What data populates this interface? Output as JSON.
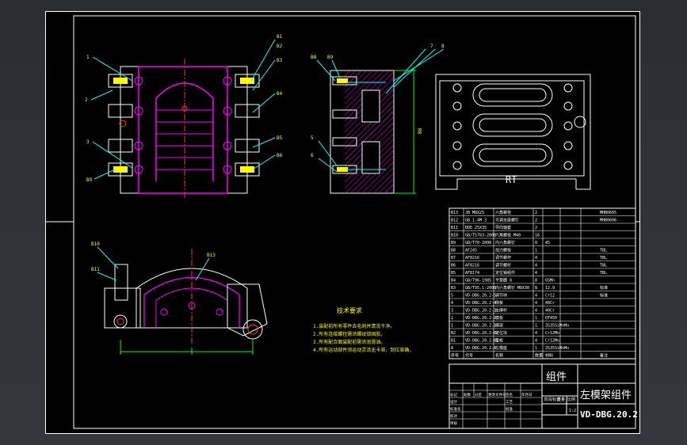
{
  "drawing": {
    "title_cn": "左模架组件",
    "drawing_no": "VD-DBG.20.2",
    "group_label": "组件",
    "scale": "1:2",
    "view_label": "RT",
    "tech_notes": {
      "heading": "技术要求",
      "lines": [
        "1.装配前所有零件去毛刺并清洗干净。",
        "2.所有连接螺栓需涂螺纹锁固胶。",
        "3.所有配合面装配前需涂润滑油。",
        "4.所有运动部件须运动灵活无卡滞，到位准确。"
      ]
    },
    "balloons_front": [
      "1",
      "2",
      "3",
      "B9"
    ],
    "balloons_right_front": [
      "B1",
      "B2",
      "B3",
      "B4",
      "B5",
      "B6"
    ],
    "balloons_section": [
      "B8",
      "B9",
      "5",
      "6",
      "7",
      "8"
    ],
    "balloons_bottom": [
      "B10",
      "B11",
      "B13"
    ],
    "dimensions": [
      "B8"
    ],
    "bom_headers": [
      "序号",
      "代号",
      "名称",
      "数量",
      "材料",
      "备注"
    ],
    "bom_rows": [
      {
        "no": "B13",
        "code": "JB M8X25",
        "name": "六角螺栓",
        "qty": "2",
        "mat": "",
        "note": "MHB0605"
      },
      {
        "no": "B12",
        "code": "GB 1.4M 3",
        "name": "可调支座螺钉",
        "qty": "2",
        "mat": "",
        "note": "MHB0606"
      },
      {
        "no": "B11",
        "code": "DDE 25X35",
        "name": "导向轴套",
        "qty": "2",
        "mat": "",
        "note": ""
      },
      {
        "no": "B10",
        "code": "GB/T5783-2000",
        "name": "六角螺栓 M40",
        "qty": "16",
        "mat": "",
        "note": ""
      },
      {
        "no": "B9",
        "code": "GB/T70-2000",
        "name": "内六角螺钉",
        "qty": "8",
        "mat": "45",
        "note": ""
      },
      {
        "no": "B8",
        "code": "AF245",
        "name": "加力螺栓",
        "qty": "1",
        "mat": "",
        "note": "TBL"
      },
      {
        "no": "B7",
        "code": "AF8216",
        "name": "调节螺杆",
        "qty": "4",
        "mat": "",
        "note": "TBL"
      },
      {
        "no": "B6",
        "code": "AF8216",
        "name": "调节螺杆",
        "qty": "4",
        "mat": "",
        "note": "TBL"
      },
      {
        "no": "B5",
        "code": "AF8174",
        "name": "定位销组件",
        "qty": "4",
        "mat": "",
        "note": "TBL"
      },
      {
        "no": "B4",
        "code": "GB/T96-1985",
        "name": "平垫圈 8",
        "qty": "8",
        "mat": "65Mn",
        "note": ""
      },
      {
        "no": "B3",
        "code": "GB/T95.1-2000",
        "name": "内六角螺钉 M8X30",
        "qty": "8",
        "mat": "12.9",
        "note": "标准"
      },
      {
        "no": "5",
        "code": "VD-DBG.20.2-5",
        "name": "调节块",
        "qty": "4",
        "mat": "Cr12",
        "note": "标准"
      },
      {
        "no": "4",
        "code": "VD-DBG.20.2-4",
        "name": "侧板",
        "qty": "4",
        "mat": "40Cr",
        "note": ""
      },
      {
        "no": "3",
        "code": "VD-DBG.20.2-3",
        "name": "支撑杆",
        "qty": "4",
        "mat": "40Cr",
        "note": ""
      },
      {
        "no": "2",
        "code": "VD-DBG.20.2-2",
        "name": "模板",
        "qty": "1",
        "mat": "QT450",
        "note": ""
      },
      {
        "no": "1",
        "code": "VD-DBG.20.2-1",
        "name": "模架",
        "qty": "1",
        "mat": "ZG35SiMnMo",
        "note": ""
      },
      {
        "no": "B2",
        "code": "VD-DBG.20.2-B2",
        "name": "定位块",
        "qty": "4",
        "mat": "Cr12Mo",
        "note": ""
      },
      {
        "no": "B1",
        "code": "VD-DBG.20.2-B1",
        "name": "垫板",
        "qty": "4",
        "mat": "Cr12Mo",
        "note": ""
      },
      {
        "no": "A",
        "code": "VD-DBG.20.2-A",
        "name": "左模座",
        "qty": "1",
        "mat": "ZG35SiMnMo",
        "note": ""
      }
    ],
    "title_block": {
      "cells": [
        "标记",
        "处数",
        "分区",
        "更改文件号",
        "签名",
        "年月日"
      ],
      "roles": [
        "设计",
        "标准化",
        "校对",
        "审核",
        "工艺",
        "批准"
      ],
      "stage_headers": [
        "阶段标记",
        "重量",
        "比例"
      ]
    }
  },
  "colors": {
    "border": "#ffffff",
    "view_lines": "#ffffff",
    "magenta": "#ff00ff",
    "label": "#ffff00",
    "leader": "#00ffff",
    "hatch": "#ff00ff",
    "dim": "#00ff00",
    "center": "#ff3333"
  }
}
